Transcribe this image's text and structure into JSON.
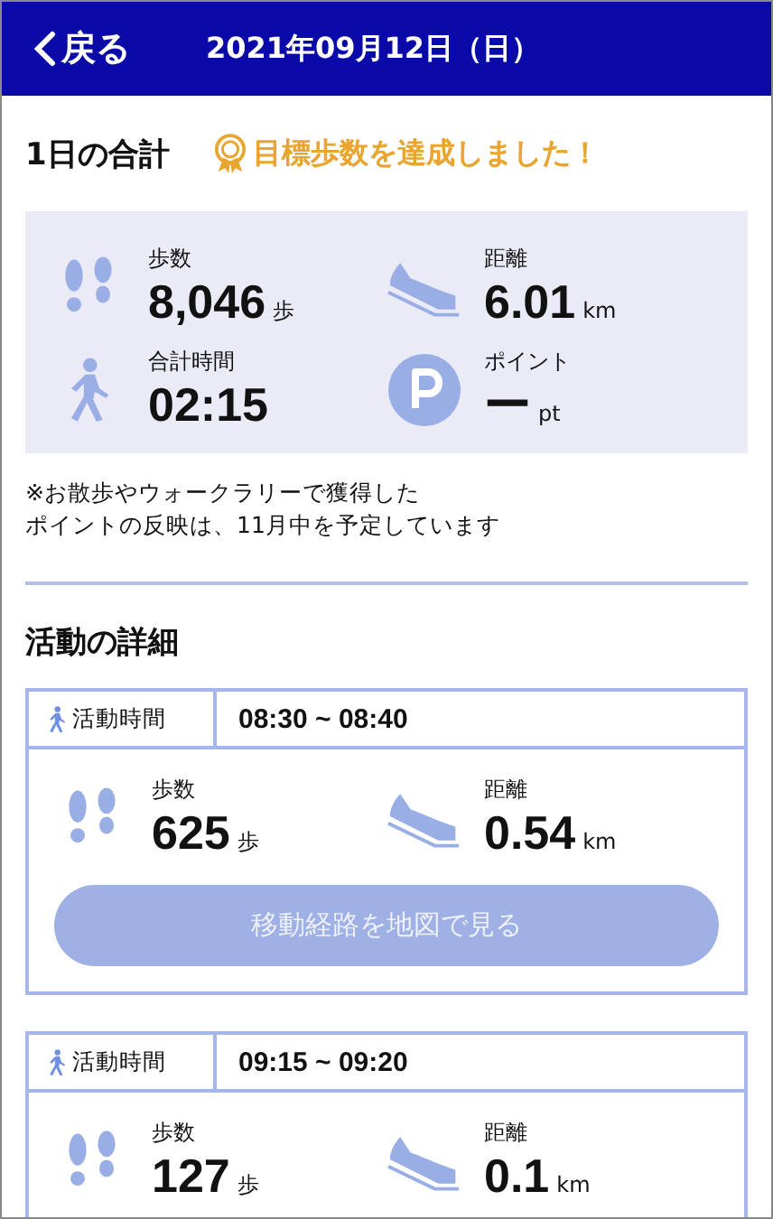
{
  "header": {
    "back": "戻る",
    "title": "2021年09月12日（日）"
  },
  "summary": {
    "title": "1日の合計",
    "achievement": "目標歩数を達成しました！",
    "stats": [
      {
        "kind": "steps",
        "label": "歩数",
        "value": "8,046",
        "unit": "歩"
      },
      {
        "kind": "distance",
        "label": "距離",
        "value": "6.01",
        "unit": "km"
      },
      {
        "kind": "time",
        "label": "合計時間",
        "value": "02:15"
      },
      {
        "kind": "points",
        "label": "ポイント",
        "value": "ー",
        "unit": "pt"
      }
    ],
    "note": [
      "※お散歩やウォークラリーで獲得した",
      "ポイントの反映は、11月中を予定しています"
    ]
  },
  "details": {
    "title": "活動の詳細",
    "activities": [
      {
        "time_label": "活動時間",
        "time": "08:30 ~ 08:40",
        "stats": [
          {
            "kind": "steps",
            "label": "歩数",
            "value": "625",
            "unit": "歩"
          },
          {
            "kind": "distance",
            "label": "距離",
            "value": "0.54",
            "unit": "km"
          }
        ],
        "button": "移動経路を地図で見る"
      },
      {
        "time_label": "活動時間",
        "time": "09:15 ~ 09:20",
        "stats": [
          {
            "kind": "steps",
            "label": "歩数",
            "value": "127",
            "unit": "歩"
          },
          {
            "kind": "distance",
            "label": "距離",
            "value": "0.1",
            "unit": "km"
          }
        ]
      }
    ]
  }
}
